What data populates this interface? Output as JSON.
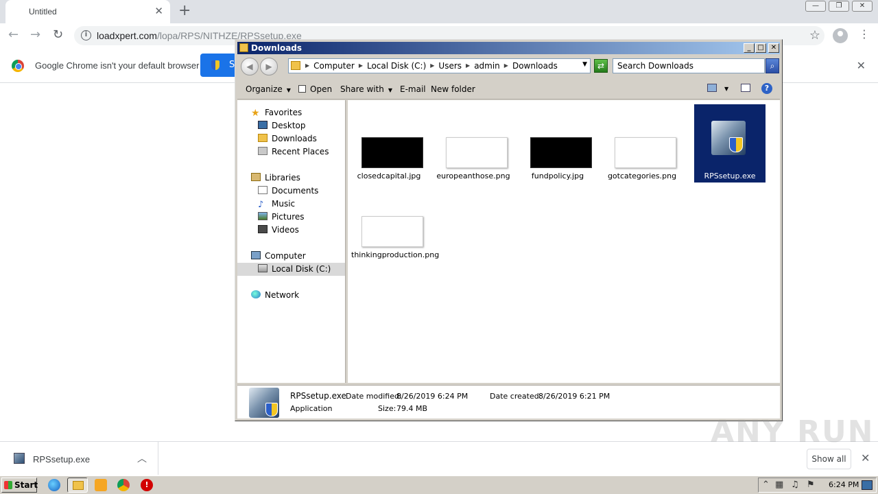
{
  "browser": {
    "tab_title": "Untitled",
    "url_host": "loadxpert.com",
    "url_path": "/lopa/RPS/NITHZE/RPSsetup.exe",
    "infobar_text": "Google Chrome isn't your default browser",
    "infobar_button": "S",
    "download_name": "RPSsetup.exe",
    "show_all": "Show all",
    "watermark": "ANY RUN"
  },
  "explorer": {
    "title": "Downloads",
    "breadcrumbs": [
      "Computer",
      "Local Disk (C:)",
      "Users",
      "admin",
      "Downloads"
    ],
    "search_placeholder": "Search Downloads",
    "commands": {
      "organize": "Organize",
      "open": "Open",
      "share": "Share with",
      "email": "E-mail",
      "new_folder": "New folder"
    },
    "nav": {
      "favorites": "Favorites",
      "desktop": "Desktop",
      "downloads": "Downloads",
      "recent": "Recent Places",
      "libraries": "Libraries",
      "documents": "Documents",
      "music": "Music",
      "pictures": "Pictures",
      "videos": "Videos",
      "computer": "Computer",
      "local_disk": "Local Disk (C:)",
      "network": "Network"
    },
    "files": [
      {
        "name": "closedcapital.jpg"
      },
      {
        "name": "europeanthose.png"
      },
      {
        "name": "fundpolicy.jpg"
      },
      {
        "name": "gotcategories.png"
      },
      {
        "name": "RPSsetup.exe"
      },
      {
        "name": "thinkingproduction.png"
      }
    ],
    "details": {
      "name": "RPSsetup.exe",
      "type": "Application",
      "modified_label": "Date modified:",
      "modified": "8/26/2019 6:24 PM",
      "created_label": "Date created:",
      "created": "8/26/2019 6:21 PM",
      "size_label": "Size:",
      "size": "79.4 MB"
    }
  },
  "taskbar": {
    "start": "Start",
    "clock": "6:24 PM"
  }
}
